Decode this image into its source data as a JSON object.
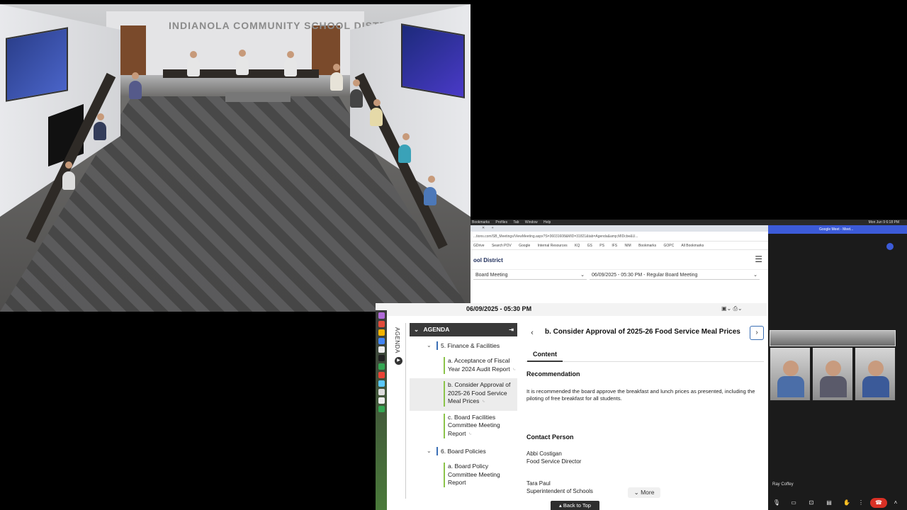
{
  "camera": {
    "wall_sign": "INDIANOLA COMMUNITY SCHOOL DISTRICT"
  },
  "mac_menu": {
    "items": [
      "Bookmarks",
      "Profiles",
      "Tab",
      "Window",
      "Help"
    ],
    "clock": "Mon Jun 9 6:18 PM"
  },
  "browser": {
    "url": "...tions.com/SB_Meetings/ViewMeeting.aspx?S=36031608&MID=31821&tab=Agenda&amp;MIDcbe&U...",
    "bookmarks": [
      "GDrive",
      "Search POV",
      "Google",
      "Internal Resources",
      "KQ",
      "GS",
      "PS",
      "IFS",
      "NIM",
      "Bookmarks",
      "GOPC",
      "All Bookmarks"
    ],
    "site_title": "ool District",
    "meeting_type": "Board Meeting",
    "meeting_select": "06/09/2025 - 05:30 PM - Regular Board Meeting",
    "date_heading": "06/09/2025 - 05:30 PM"
  },
  "agenda": {
    "header": "AGENDA",
    "vertical_label": "AGENDA",
    "sections": [
      {
        "title": "5. Finance & Facilities",
        "items": [
          "a. Acceptance of Fiscal Year 2024 Audit Report",
          "b. Consider Approval of 2025-26 Food Service Meal Prices",
          "c. Board Facilities Committee Meeting Report"
        ]
      },
      {
        "title": "6. Board Policies",
        "items": [
          "a. Board Policy Committee Meeting Report"
        ]
      }
    ]
  },
  "detail": {
    "title": "b. Consider Approval of 2025-26 Food Service Meal Prices",
    "tab": "Content",
    "rec_heading": "Recommendation",
    "rec_text": "It is recommended the board approve the breakfast and lunch prices as presented, including the piloting of free breakfast for all students.",
    "contact_heading": "Contact Person",
    "contact1_name": "Abbi Costigan",
    "contact1_role": "Food Service Director",
    "contact2_name": "Tara Paul",
    "contact2_role": "Superintendent of Schools",
    "more_label": "More",
    "back_to_top": "Back to Top"
  },
  "meet": {
    "tab_title": "Google Meet - Meet...",
    "participant_name": "Ray Coffey"
  },
  "colors": {
    "accent": "#3b6fb5",
    "item_bar": "#8bc34a",
    "meet_blue": "#3c5bd8",
    "hangup": "#d93025"
  }
}
